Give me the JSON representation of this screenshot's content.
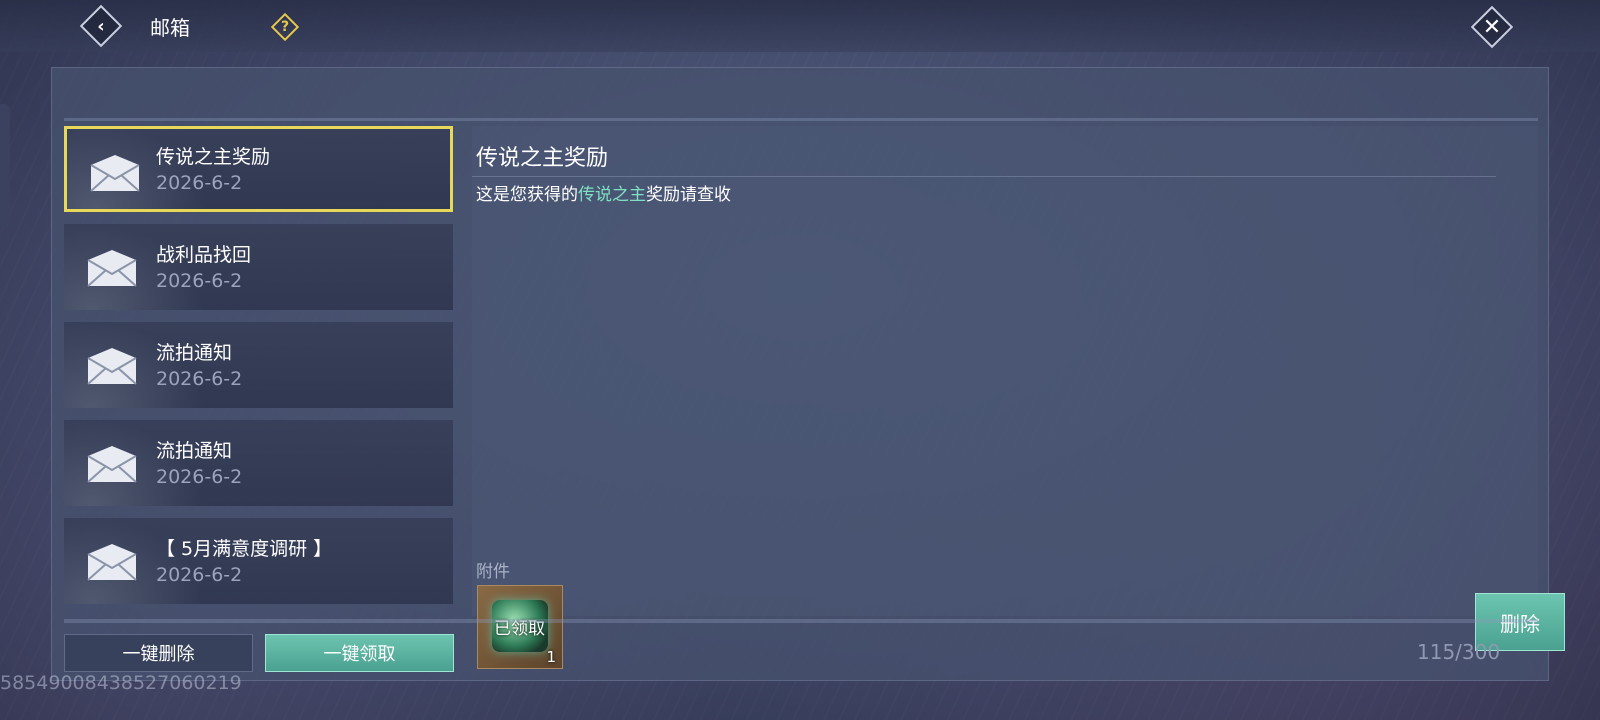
{
  "header": {
    "title": "邮箱",
    "help_icon_text": "?"
  },
  "mails": [
    {
      "title": "传说之主奖励",
      "date": "2026-6-2",
      "selected": true
    },
    {
      "title": "战利品找回",
      "date": "2026-6-2",
      "selected": false
    },
    {
      "title": "流拍通知",
      "date": "2026-6-2",
      "selected": false
    },
    {
      "title": "流拍通知",
      "date": "2026-6-2",
      "selected": false
    },
    {
      "title": "【 5月满意度调研 】",
      "date": "2026-6-2",
      "selected": false
    }
  ],
  "detail": {
    "title": "传说之主奖励",
    "body_prefix": "这是您获得的",
    "body_highlight": "传说之主",
    "body_suffix": "奖励请查收",
    "attachment_label": "附件",
    "attachment": {
      "status_text": "已领取",
      "quantity": "1",
      "icon": "gem-chest-icon"
    },
    "delete_label": "删除"
  },
  "footer": {
    "delete_all_label": "一键删除",
    "claim_all_label": "一键领取",
    "mail_count": "115/300"
  },
  "uid": "585490084385270602​19",
  "colors": {
    "accent": "#5bb3a0",
    "highlight_text": "#7fe0c2",
    "selected_border": "#e8d85a"
  }
}
